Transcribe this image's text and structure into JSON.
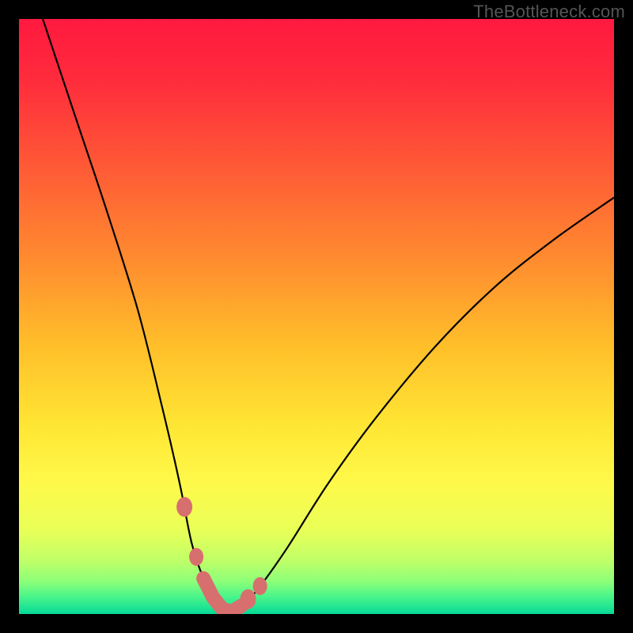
{
  "watermark": "TheBottleneck.com",
  "chart_data": {
    "type": "line",
    "title": "",
    "xlabel": "",
    "ylabel": "",
    "ylim": [
      0,
      100
    ],
    "xlim": [
      0,
      100
    ],
    "series": [
      {
        "name": "bottleneck-curve",
        "x": [
          4,
          10,
          15,
          20,
          24,
          27,
          29,
          31,
          33,
          35,
          37,
          40,
          45,
          52,
          60,
          70,
          80,
          90,
          100
        ],
        "values": [
          100,
          82,
          67,
          51,
          35,
          22,
          12,
          6,
          2,
          0,
          1,
          4,
          11,
          22,
          33,
          45,
          55,
          63,
          70
        ]
      }
    ],
    "annotations": {
      "optimal_region_x": [
        29,
        40
      ],
      "optimal_value": 0
    },
    "background_gradient": {
      "stops": [
        {
          "pos": 0.0,
          "color": "#ff193f"
        },
        {
          "pos": 0.1,
          "color": "#ff2b3c"
        },
        {
          "pos": 0.25,
          "color": "#ff5a36"
        },
        {
          "pos": 0.4,
          "color": "#ff8a2f"
        },
        {
          "pos": 0.55,
          "color": "#ffbf2a"
        },
        {
          "pos": 0.68,
          "color": "#ffe533"
        },
        {
          "pos": 0.78,
          "color": "#fff94a"
        },
        {
          "pos": 0.86,
          "color": "#e8ff57"
        },
        {
          "pos": 0.91,
          "color": "#c0ff68"
        },
        {
          "pos": 0.945,
          "color": "#8dff79"
        },
        {
          "pos": 0.97,
          "color": "#4cf58a"
        },
        {
          "pos": 0.99,
          "color": "#1de493"
        },
        {
          "pos": 1.0,
          "color": "#06d998"
        }
      ]
    },
    "marker_color": "#d86f6f",
    "curve_color": "#000000"
  }
}
